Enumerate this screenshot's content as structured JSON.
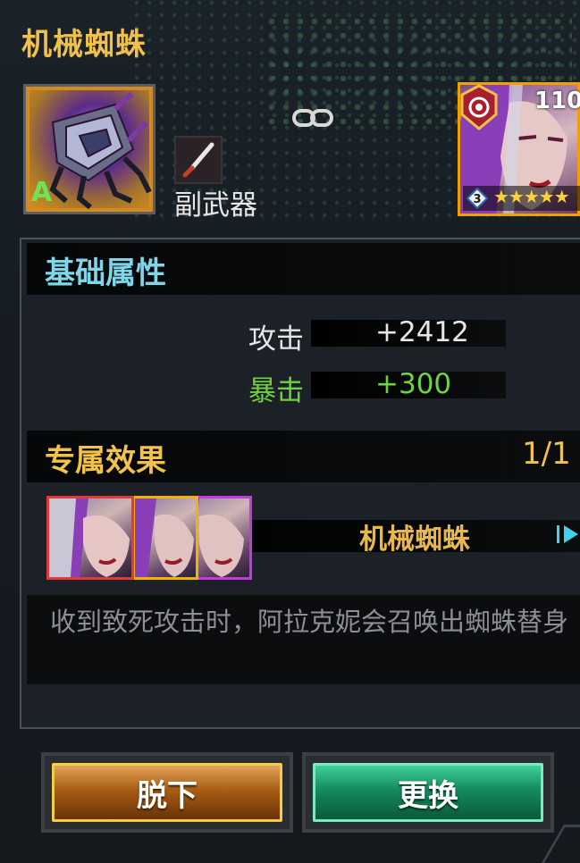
{
  "item": {
    "name": "机械蜘蛛",
    "grade": "A",
    "slot_label": "副武器",
    "icon": "mechanical-spider"
  },
  "hero": {
    "level": "110",
    "rank": "3",
    "stars": "★★★★★",
    "class_icon": "target-icon"
  },
  "base_attributes": {
    "title": "基础属性",
    "stats": [
      {
        "name": "攻击",
        "value": "+2412",
        "color": "#e6e6e6"
      },
      {
        "name": "暴击",
        "value": "+300",
        "color": "#6ed33f"
      }
    ]
  },
  "exclusive_effect": {
    "title": "专属效果",
    "count": "1/1",
    "effect_name": "机械蜘蛛",
    "portrait_borders": [
      "#e23a3a",
      "#f0b400",
      "#c23ae0"
    ],
    "description": "收到致死攻击时，阿拉克妮会召唤出蜘蛛替身"
  },
  "buttons": {
    "unequip": "脱下",
    "replace": "更换"
  },
  "colors": {
    "title_gold": "#f0c04a",
    "section_cyan": "#7fd6e8",
    "section_gold": "#f2c24a",
    "crit_green": "#6ed33f"
  }
}
